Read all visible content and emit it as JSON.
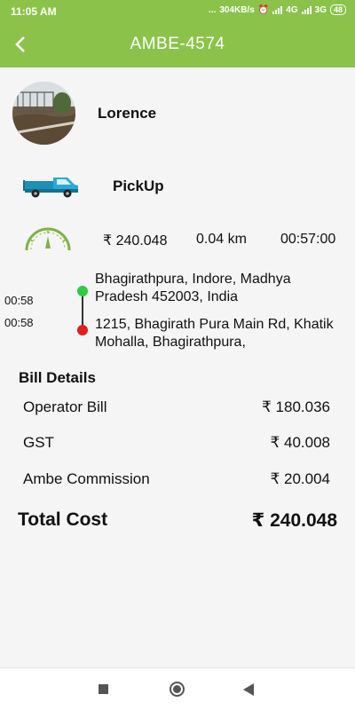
{
  "status_bar": {
    "time": "11:05 AM",
    "indicators": "...",
    "speed": "304KB/s",
    "network_1": "4G",
    "network_2": "3G",
    "battery": "48"
  },
  "app_bar": {
    "back_icon": "chevron-left-icon",
    "title": "AMBE-4574"
  },
  "driver": {
    "name": "Lorence",
    "avatar_icon": "driver-photo"
  },
  "vehicle": {
    "type": "PickUp",
    "icon": "pickup-truck-icon"
  },
  "trip": {
    "gauge_icon": "speedometer-icon",
    "fare": "₹ 240.048",
    "distance": "0.04 km",
    "duration": "00:57:00"
  },
  "route": {
    "pickup_time": "00:58",
    "drop_time": "00:58",
    "pickup_address": "Bhagirathpura, Indore, Madhya Pradesh 452003, India",
    "drop_address": "1215, Bhagirath Pura Main Rd, Khatik Mohalla, Bhagirathpura,",
    "pickup_color": "#2ecc40",
    "drop_color": "#e0201c"
  },
  "bill": {
    "title": "Bill Details",
    "items": [
      {
        "label": "Operator Bill",
        "amount": "₹ 180.036"
      },
      {
        "label": "GST",
        "amount": "₹ 40.008"
      },
      {
        "label": "Ambe Commission",
        "amount": "₹ 20.004"
      }
    ],
    "total_label": "Total Cost",
    "total_amount": "₹ 240.048"
  },
  "nav_bar": {
    "recent_icon": "square-icon",
    "home_icon": "circle-icon",
    "back_icon": "triangle-back-icon"
  },
  "colors": {
    "accent": "#8bc34a",
    "background": "#f5f5f5"
  }
}
